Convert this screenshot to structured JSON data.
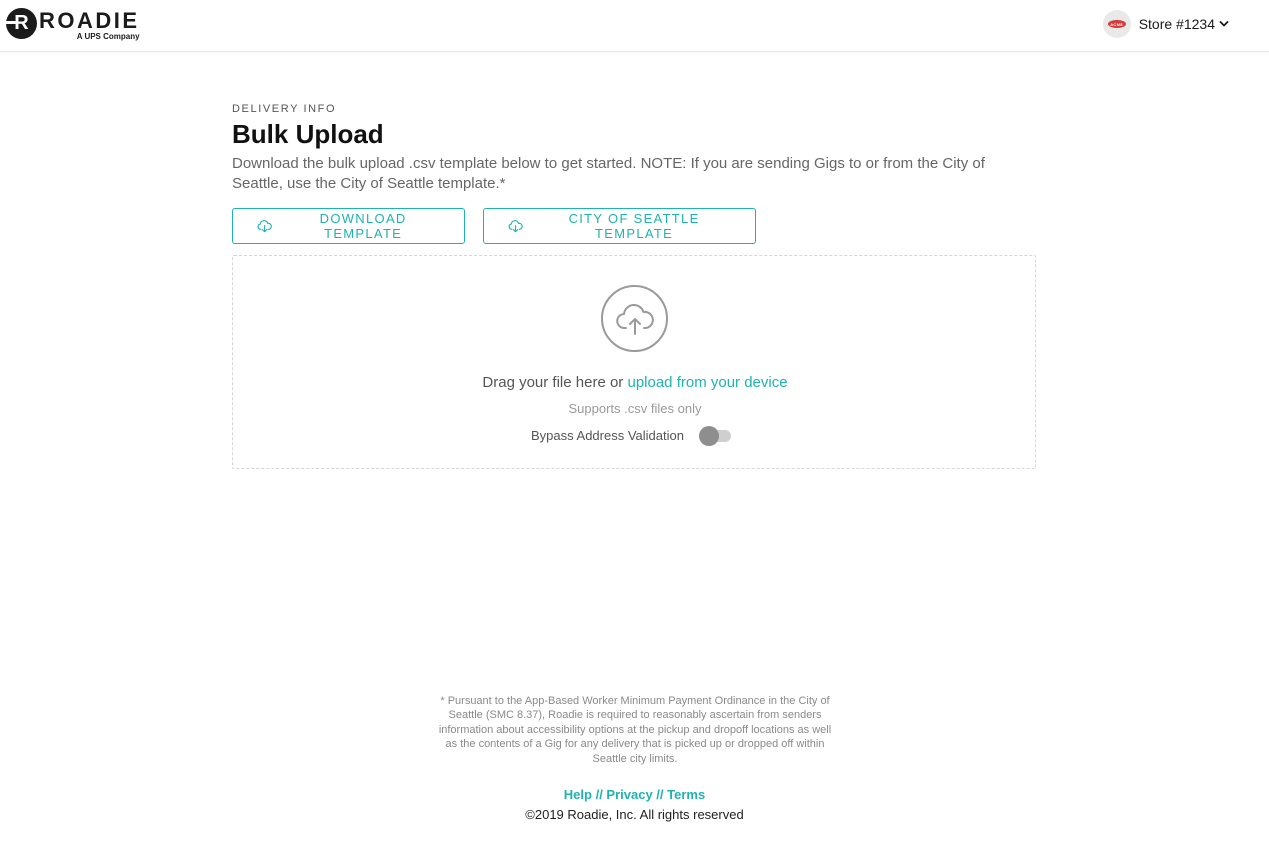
{
  "header": {
    "logo_mark": "R",
    "logo_word": "ROADIE",
    "logo_sub": "A UPS Company",
    "store_avatar_text": "ACME",
    "store_name": "Store #1234"
  },
  "main": {
    "eyebrow": "DELIVERY INFO",
    "title": "Bulk Upload",
    "description": "Download the bulk upload .csv template below to get started. NOTE: If you are sending Gigs to or from the City of Seattle, use the City of Seattle template.*",
    "buttons": {
      "download_template": "DOWNLOAD TEMPLATE",
      "seattle_template": "CITY OF SEATTLE TEMPLATE"
    },
    "dropzone": {
      "drag_text": "Drag your file here or ",
      "upload_link": "upload from your device",
      "supports": "Supports .csv files only",
      "bypass_label": "Bypass Address Validation",
      "bypass_enabled": false
    }
  },
  "footer": {
    "disclaimer": "* Pursuant to the App-Based Worker Minimum Payment Ordinance in the City of Seattle (SMC 8.37), Roadie is required to reasonably ascertain from senders information about accessibility options at the pickup and dropoff locations as well as the contents of a Gig for any delivery that is picked up or dropped off within Seattle city limits.",
    "links": {
      "help": "Help",
      "privacy": "Privacy",
      "terms": "Terms",
      "separator": " // "
    },
    "copyright": "©2019 Roadie, Inc. All rights reserved"
  },
  "colors": {
    "accent": "#1fb3b0",
    "text": "#1a1a1a",
    "muted": "#666666",
    "store_avatar": "#d63a3a"
  }
}
